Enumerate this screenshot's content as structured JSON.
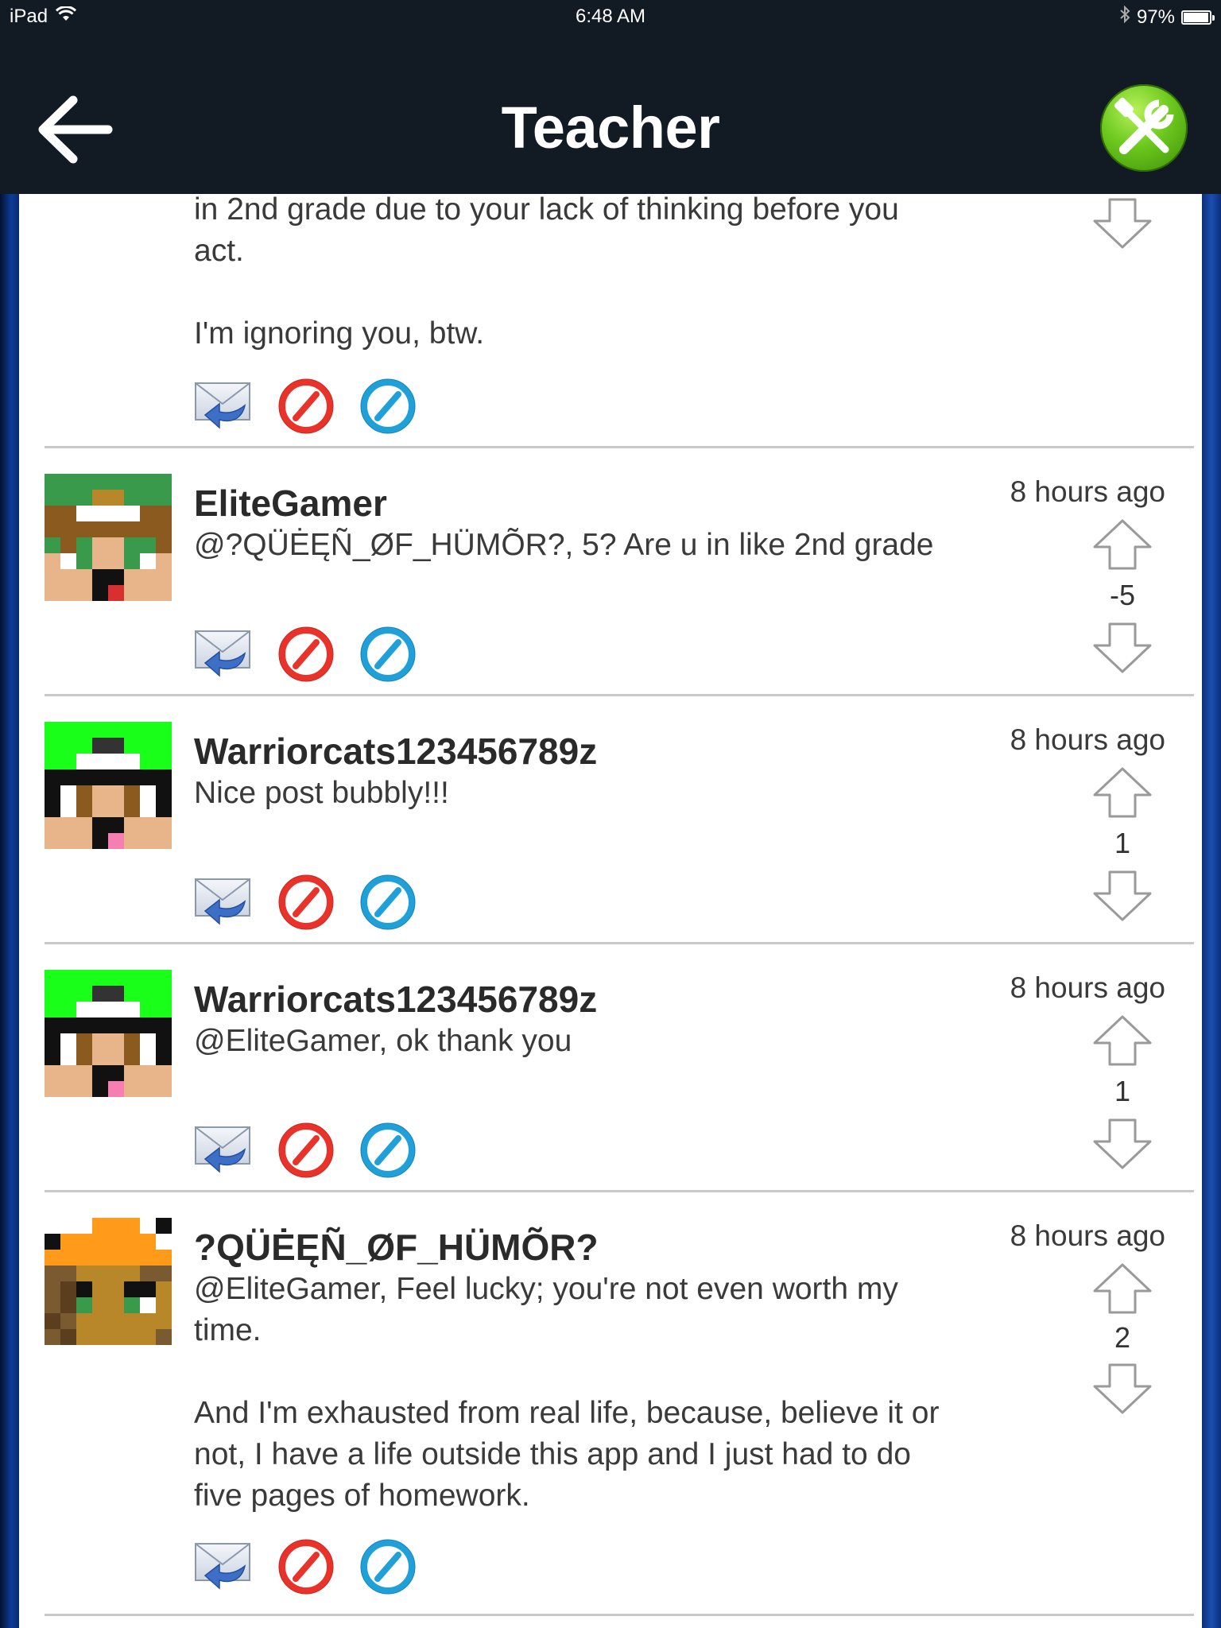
{
  "status": {
    "device": "iPad",
    "time": "6:48 AM",
    "battery": "97%",
    "battery_level": 0.97
  },
  "nav": {
    "title": "Teacher"
  },
  "partial_post": {
    "message": "in 2nd grade due to your lack of thinking before you\nact.\n\nI'm ignoring you, btw."
  },
  "posts": [
    {
      "username": "EliteGamer",
      "time": "8 hours ago",
      "message": "@?QÜĖĘÑ_ØF_HÜMÕR?, 5? Are u in like 2nd grade",
      "score": "-5"
    },
    {
      "username": "Warriorcats123456789z",
      "time": "8 hours ago",
      "message": "Nice post bubbly!!!",
      "score": "1"
    },
    {
      "username": "Warriorcats123456789z",
      "time": "8 hours ago",
      "message": "@EliteGamer, ok thank you",
      "score": "1"
    },
    {
      "username": "?QÜĖĘÑ_ØF_HÜMÕR?",
      "time": "8 hours ago",
      "message": "@EliteGamer, Feel lucky; you're not even worth my\ntime.\n\nAnd I'm exhausted from real life, because, believe it or\nnot, I have a life outside this app and I just had to do\nfive pages of homework.",
      "score": "2"
    }
  ],
  "icons": {
    "reply": "reply-mail-icon",
    "report": "red-prohibited-icon",
    "ignore": "blue-ignore-icon",
    "upvote": "up-arrow-icon",
    "downvote": "down-arrow-icon"
  },
  "colors": {
    "nav_bg": "#121a24",
    "tools_green": "#6cc81e",
    "report_red": "#e8322a",
    "ignore_blue": "#1fa0d8"
  }
}
